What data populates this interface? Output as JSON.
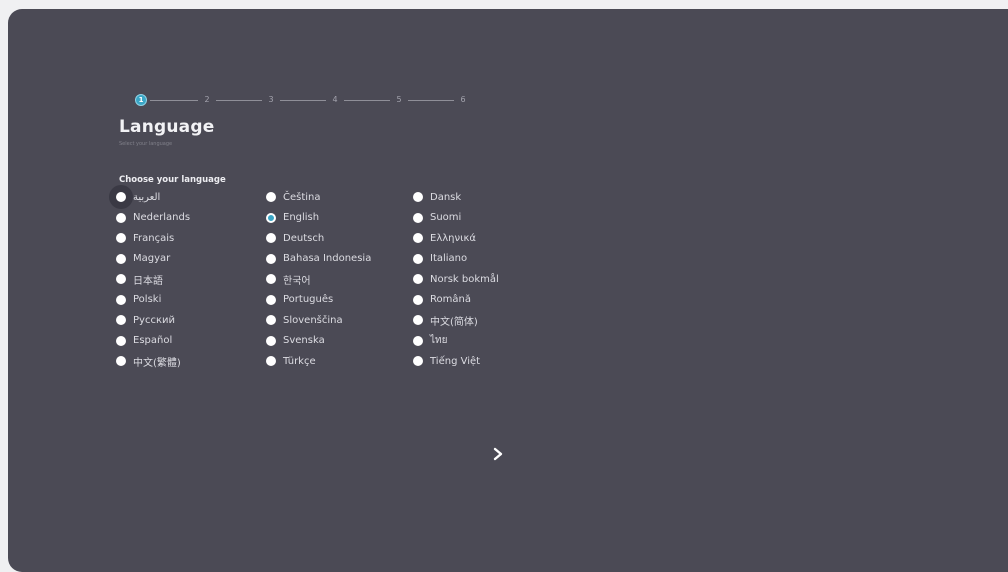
{
  "stepper": {
    "steps": [
      "1",
      "2",
      "3",
      "4",
      "5",
      "6"
    ]
  },
  "header": {
    "title": "Language",
    "subtitle": "Select your language"
  },
  "section_label": "Choose your language",
  "selected_language": "English",
  "focused_language": "العربية",
  "next_icon": "chevron-right-icon",
  "colors": {
    "panel": "#4b4a55",
    "accent": "#3aa6c6",
    "radio": "#ffffff"
  },
  "languages": [
    [
      "العربية",
      "Čeština",
      "Dansk"
    ],
    [
      "Nederlands",
      "English",
      "Suomi"
    ],
    [
      "Français",
      "Deutsch",
      "Ελληνικά"
    ],
    [
      "Magyar",
      "Bahasa Indonesia",
      "Italiano"
    ],
    [
      "日本語",
      "한국어",
      "Norsk bokmål"
    ],
    [
      "Polski",
      "Português",
      "Română"
    ],
    [
      "Русский",
      "Slovenščina",
      "中文(简体)"
    ],
    [
      "Español",
      "Svenska",
      "ไทย"
    ],
    [
      "中文(繁體)",
      "Türkçe",
      "Tiếng Việt"
    ]
  ]
}
